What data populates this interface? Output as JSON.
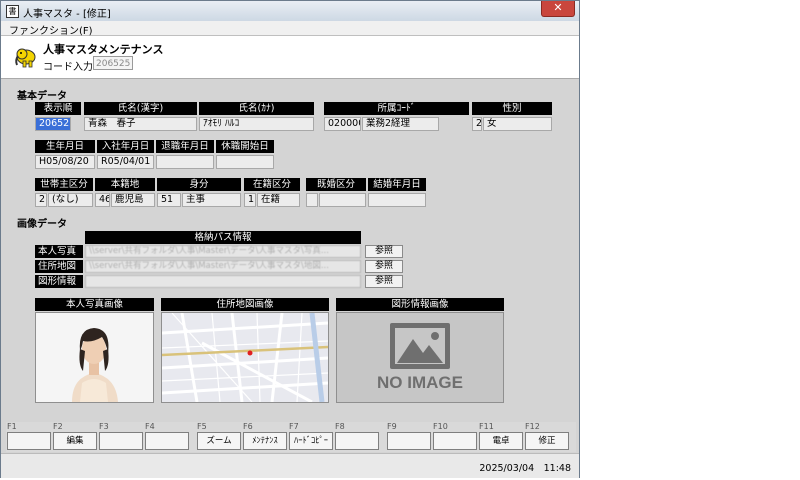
{
  "window": {
    "title": "人事マスタ - [修正]",
    "icon": "書",
    "close": "✕"
  },
  "menu": {
    "functions": "ファンクション(F)"
  },
  "header": {
    "screen_title": "人事マスタメンテナンス",
    "code_label": "コード入力",
    "code_value": "206525"
  },
  "basic": {
    "section_title": "基本データ",
    "headers": {
      "display_no": "表示順",
      "name_kanji": "氏名(漢字)",
      "name_kana": "氏名(ｶﾅ)",
      "dept_code": "所属ｺｰﾄﾞ",
      "gender": "性別",
      "birth": "生年月日",
      "hire": "入社年月日",
      "retire": "退職年月日",
      "leave_start": "休職開始日",
      "household": "世帯主区分",
      "domicile": "本籍地",
      "status": "身分",
      "enroll": "在籍区分",
      "marital": "既婚区分",
      "marriage_date": "結婚年月日"
    },
    "values": {
      "display_no": "206525",
      "name_kanji": "青森　春子",
      "name_kana": "ｱｵﾓﾘ ﾊﾙｺ",
      "dept_code": "020000",
      "dept_name": "業務2経理",
      "gender_code": "2",
      "gender_name": "女",
      "birth": "H05/08/20",
      "hire": "R05/04/01",
      "retire": "",
      "leave_start": "",
      "household_code": "2",
      "household_name": "(なし)",
      "domicile_code": "46",
      "domicile_name": "鹿児島",
      "status_code": "51",
      "status_name": "主事",
      "enroll_code": "1",
      "enroll_name": "在籍",
      "marital_code": "",
      "marital_name": "",
      "marriage_date": ""
    }
  },
  "images": {
    "section_title": "画像データ",
    "path_header": "格納パス情報",
    "rows": [
      {
        "label": "本人写真",
        "path": "\\\\server\\共有フォルダ\\人事\\Master\\データ\\人事マスタ\\写真...",
        "button": "参照"
      },
      {
        "label": "住所地図",
        "path": "\\\\server\\共有フォルダ\\人事\\Master\\データ\\人事マスタ\\地図...",
        "button": "参照"
      },
      {
        "label": "図形情報",
        "path": "",
        "button": "参照"
      }
    ],
    "panel_titles": {
      "photo": "本人写真画像",
      "map": "住所地図画像",
      "figure": "図形情報画像"
    },
    "no_image_text": "NO IMAGE"
  },
  "fkeys": [
    {
      "num": "F1",
      "label": ""
    },
    {
      "num": "F2",
      "label": "編集"
    },
    {
      "num": "F3",
      "label": ""
    },
    {
      "num": "F4",
      "label": ""
    },
    {
      "num": "F5",
      "label": "ズーム"
    },
    {
      "num": "F6",
      "label": "ﾒﾝﾃﾅﾝｽ"
    },
    {
      "num": "F7",
      "label": "ﾊｰﾄﾞｺﾋﾟｰ"
    },
    {
      "num": "F8",
      "label": ""
    },
    {
      "num": "F9",
      "label": ""
    },
    {
      "num": "F10",
      "label": ""
    },
    {
      "num": "F11",
      "label": "電卓"
    },
    {
      "num": "F12",
      "label": "修正"
    }
  ],
  "status": {
    "datetime": "2025/03/04　11:48"
  },
  "colors": {
    "window_bg": "#d4d4d4",
    "header_black": "#000000",
    "selected": "#3a6fd8",
    "map_road": "#ffffff",
    "map_bg": "#e8e8ee"
  }
}
